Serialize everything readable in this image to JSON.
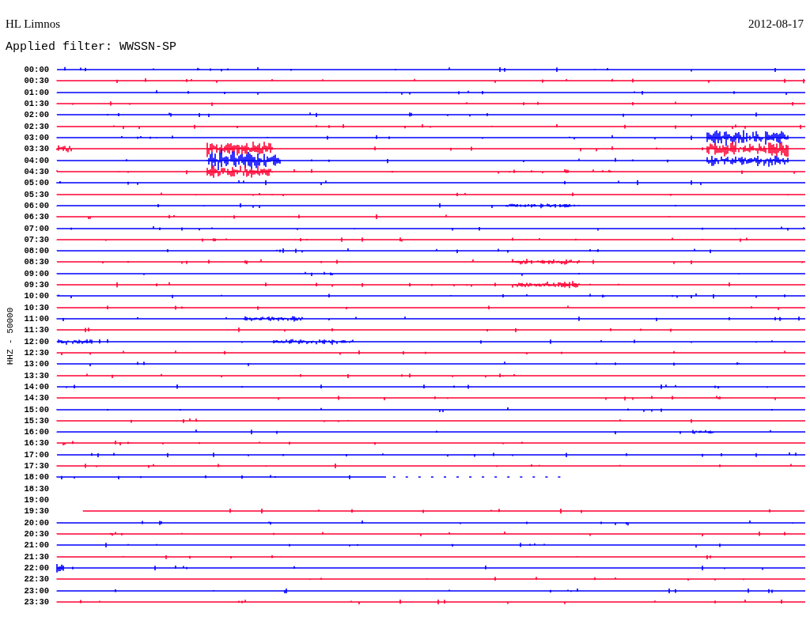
{
  "station": "HL Limnos",
  "date": "2012-08-17",
  "filter": "Applied filter: WWSSN-SP",
  "axis_label": "HHZ - 50000",
  "traces": [
    {
      "time": "00:00",
      "color": "#0000ff",
      "kind": "full"
    },
    {
      "time": "00:30",
      "color": "#ff0033",
      "kind": "full"
    },
    {
      "time": "01:00",
      "color": "#0000ff",
      "kind": "full"
    },
    {
      "time": "01:30",
      "color": "#ff0033",
      "kind": "full"
    },
    {
      "time": "02:00",
      "color": "#0000ff",
      "kind": "full"
    },
    {
      "time": "02:30",
      "color": "#ff0033",
      "kind": "full"
    },
    {
      "time": "03:00",
      "color": "#0000ff",
      "kind": "full"
    },
    {
      "time": "03:30",
      "color": "#ff0033",
      "kind": "full"
    },
    {
      "time": "04:00",
      "color": "#0000ff",
      "kind": "full"
    },
    {
      "time": "04:30",
      "color": "#ff0033",
      "kind": "full"
    },
    {
      "time": "05:00",
      "color": "#0000ff",
      "kind": "full"
    },
    {
      "time": "05:30",
      "color": "#ff0033",
      "kind": "full"
    },
    {
      "time": "06:00",
      "color": "#0000ff",
      "kind": "full"
    },
    {
      "time": "06:30",
      "color": "#ff0033",
      "kind": "full"
    },
    {
      "time": "07:00",
      "color": "#0000ff",
      "kind": "full"
    },
    {
      "time": "07:30",
      "color": "#ff0033",
      "kind": "full"
    },
    {
      "time": "08:00",
      "color": "#0000ff",
      "kind": "full"
    },
    {
      "time": "08:30",
      "color": "#ff0033",
      "kind": "full"
    },
    {
      "time": "09:00",
      "color": "#0000ff",
      "kind": "full"
    },
    {
      "time": "09:30",
      "color": "#ff0033",
      "kind": "full"
    },
    {
      "time": "10:00",
      "color": "#0000ff",
      "kind": "full"
    },
    {
      "time": "10:30",
      "color": "#ff0033",
      "kind": "full"
    },
    {
      "time": "11:00",
      "color": "#0000ff",
      "kind": "full"
    },
    {
      "time": "11:30",
      "color": "#ff0033",
      "kind": "full"
    },
    {
      "time": "12:00",
      "color": "#0000ff",
      "kind": "full"
    },
    {
      "time": "12:30",
      "color": "#ff0033",
      "kind": "full"
    },
    {
      "time": "13:00",
      "color": "#0000ff",
      "kind": "full"
    },
    {
      "time": "13:30",
      "color": "#ff0033",
      "kind": "full"
    },
    {
      "time": "14:00",
      "color": "#0000ff",
      "kind": "full"
    },
    {
      "time": "14:30",
      "color": "#ff0033",
      "kind": "full"
    },
    {
      "time": "15:00",
      "color": "#0000ff",
      "kind": "full"
    },
    {
      "time": "15:30",
      "color": "#ff0033",
      "kind": "full"
    },
    {
      "time": "16:00",
      "color": "#0000ff",
      "kind": "full"
    },
    {
      "time": "16:30",
      "color": "#ff0033",
      "kind": "full"
    },
    {
      "time": "17:00",
      "color": "#0000ff",
      "kind": "full"
    },
    {
      "time": "17:30",
      "color": "#ff0033",
      "kind": "full"
    },
    {
      "time": "18:00",
      "color": "#0000ff",
      "kind": "ends_early"
    },
    {
      "time": "18:30",
      "kind": "gap"
    },
    {
      "time": "19:00",
      "kind": "gap"
    },
    {
      "time": "19:30",
      "color": "#ff0033",
      "kind": "starts_late"
    },
    {
      "time": "20:00",
      "color": "#0000ff",
      "kind": "full"
    },
    {
      "time": "20:30",
      "color": "#ff0033",
      "kind": "full"
    },
    {
      "time": "21:00",
      "color": "#0000ff",
      "kind": "full"
    },
    {
      "time": "21:30",
      "color": "#ff0033",
      "kind": "full"
    },
    {
      "time": "22:00",
      "color": "#0000ff",
      "kind": "full"
    },
    {
      "time": "22:30",
      "color": "#ff0033",
      "kind": "full"
    },
    {
      "time": "23:00",
      "color": "#0000ff",
      "kind": "full"
    },
    {
      "time": "23:30",
      "color": "#ff0033",
      "kind": "full"
    }
  ]
}
